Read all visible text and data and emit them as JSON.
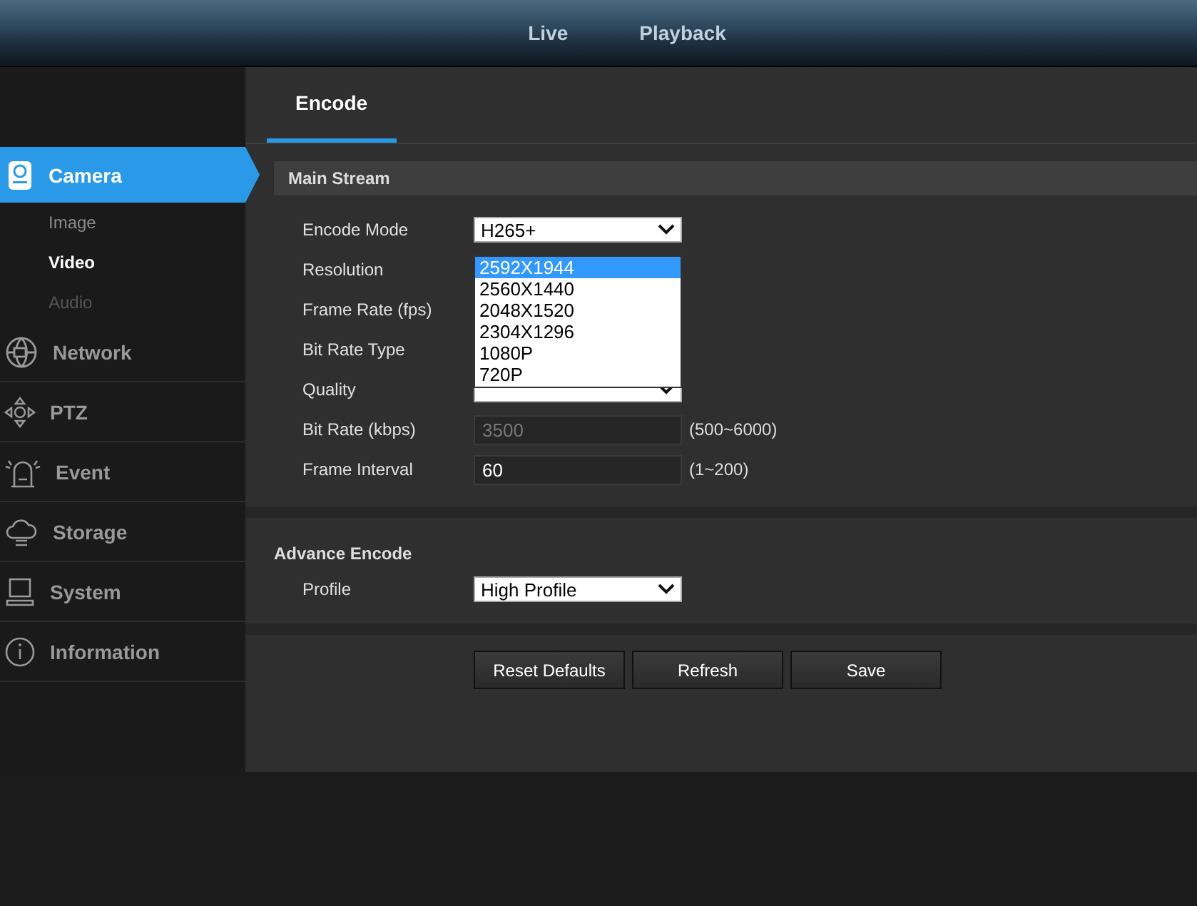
{
  "nav": [
    {
      "label": "Live",
      "selected": false
    },
    {
      "label": "Playback",
      "selected": false
    }
  ],
  "sidebar": {
    "items": [
      {
        "label": "Camera",
        "selected": true,
        "children": [
          {
            "label": "Image",
            "selected": false,
            "disabled": false
          },
          {
            "label": "Video",
            "selected": true,
            "disabled": false
          },
          {
            "label": "Audio",
            "selected": false,
            "disabled": true
          }
        ]
      },
      {
        "label": "Network",
        "selected": false
      },
      {
        "label": "PTZ",
        "selected": false
      },
      {
        "label": "Event",
        "selected": false
      },
      {
        "label": "Storage",
        "selected": false
      },
      {
        "label": "System",
        "selected": false
      },
      {
        "label": "Information",
        "selected": false
      }
    ]
  },
  "tabs": [
    {
      "label": "Encode",
      "selected": true
    }
  ],
  "main_stream": {
    "title": "Main Stream",
    "fields": [
      {
        "label": "Encode Mode",
        "kind": "select",
        "value": "H265+"
      },
      {
        "label": "Resolution",
        "kind": "select",
        "open": true,
        "options": [
          {
            "label": "2592X1944",
            "selected": true
          },
          {
            "label": "2560X1440",
            "selected": false
          },
          {
            "label": "2048X1520",
            "selected": false
          },
          {
            "label": "2304X1296",
            "selected": false
          },
          {
            "label": "1080P",
            "selected": false
          },
          {
            "label": "720P",
            "selected": false
          }
        ]
      },
      {
        "label": "Frame Rate (fps)",
        "kind": "covered"
      },
      {
        "label": "Bit Rate Type",
        "kind": "covered"
      },
      {
        "label": "Quality",
        "kind": "select"
      },
      {
        "label": "Bit Rate (kbps)",
        "kind": "input",
        "value": "3500",
        "disabled": true,
        "range": "(500~6000)"
      },
      {
        "label": "Frame Interval",
        "kind": "input",
        "value": "60",
        "disabled": false,
        "range": "(1~200)"
      }
    ]
  },
  "advance_encode": {
    "title": "Advance Encode",
    "fields": [
      {
        "label": "Profile",
        "kind": "select",
        "value": "High Profile"
      }
    ]
  },
  "buttons": [
    "Reset Defaults",
    "Refresh",
    "Save"
  ]
}
